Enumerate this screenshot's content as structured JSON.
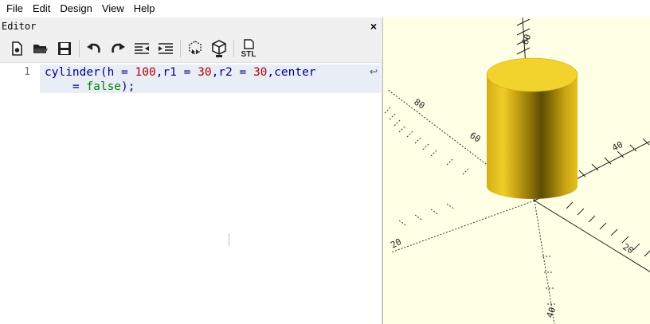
{
  "menubar": {
    "file": "File",
    "edit": "Edit",
    "design": "Design",
    "view": "View",
    "help": "Help"
  },
  "editor": {
    "title": "Editor",
    "close_label": "×",
    "toolbar": {
      "icons": [
        "new-file-icon",
        "open-file-icon",
        "save-icon",
        "undo-icon",
        "redo-icon",
        "unindent-icon",
        "indent-icon",
        "preview-render-icon",
        "render-icon",
        "export-stl-icon"
      ],
      "stl_label": "STL"
    },
    "code": {
      "line_number": "1",
      "tokens": {
        "fn": "cylinder(h = ",
        "v1": "100",
        "s1": ",r1 = ",
        "v2": "30",
        "s2": ",r2 = ",
        "v3": "30",
        "s3": ",center",
        "s4": "    = ",
        "kw": "false",
        "s5": ");"
      },
      "wrap_indicator": "↩"
    }
  },
  "viewport": {
    "background": "#ffffe5",
    "object": "cylinder",
    "object_color": "#e8c21c",
    "axis_labels": [
      "20",
      "40",
      "60",
      "80"
    ]
  }
}
